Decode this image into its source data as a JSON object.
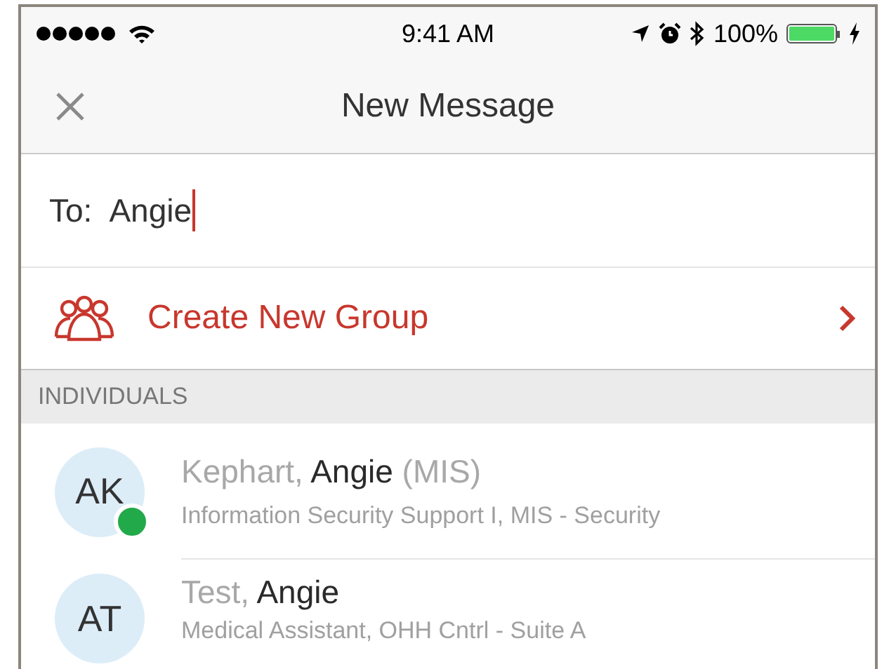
{
  "status_bar": {
    "time": "9:41 AM",
    "battery": "100%",
    "level": 1,
    "charging": true
  },
  "nav": {
    "title": "New Message"
  },
  "to_field": {
    "label": "To:",
    "value": "Angie"
  },
  "create_group": {
    "label": "Create New Group"
  },
  "section": {
    "title": "INDIVIDUALS"
  },
  "contacts": [
    {
      "initials": "AK",
      "name": "Kephart, **Angie** (MIS)",
      "detail": "Information Security Support I, MIS - Security",
      "online": true
    },
    {
      "initials": "AT",
      "name": "Test, **Angie**",
      "detail": "Medical Assistant, OHH Cntrl - Suite A",
      "online": false
    }
  ]
}
